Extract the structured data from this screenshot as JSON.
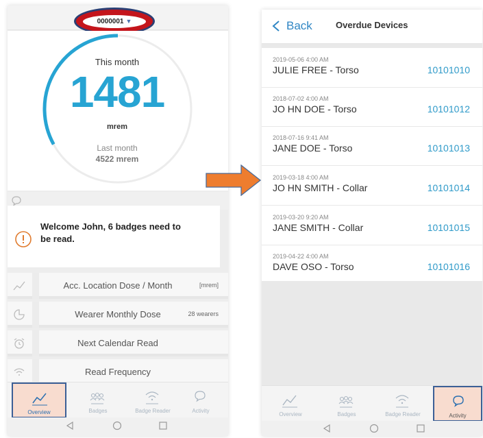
{
  "left": {
    "device_selector": {
      "value": "0000001"
    },
    "summary": {
      "this_month_label": "This month",
      "this_month_value": "1481",
      "unit": "mrem",
      "last_month_label": "Last month",
      "last_month_value": "4522 mrem",
      "gauge_fraction": 0.33
    },
    "welcome": {
      "text": "Welcome John, 6 badges need to be read."
    },
    "menu": [
      {
        "label": "Acc. Location Dose / Month",
        "meta": "[mrem]",
        "icon": "line-chart-icon"
      },
      {
        "label": "Wearer Monthly Dose",
        "meta": "28 wearers",
        "icon": "pie-chart-icon"
      },
      {
        "label": "Next Calendar Read",
        "meta": "",
        "icon": "alarm-clock-icon"
      },
      {
        "label": "Read Frequency",
        "meta": "",
        "icon": "wifi-icon"
      }
    ],
    "tabs": [
      {
        "label": "Overview",
        "icon": "line-chart-icon",
        "active": true
      },
      {
        "label": "Badges",
        "icon": "people-icon",
        "active": false
      },
      {
        "label": "Badge Reader",
        "icon": "wifi-icon",
        "active": false
      },
      {
        "label": "Activity",
        "icon": "chat-icon",
        "active": false
      }
    ]
  },
  "right": {
    "back_label": "Back",
    "title": "Overdue Devices",
    "devices": [
      {
        "datetime": "2019-05-06 4:00 AM",
        "name": "JULIE FREE - Torso",
        "id": "10101010"
      },
      {
        "datetime": "2018-07-02 4:00 AM",
        "name": "JO HN DOE - Torso",
        "id": "10101012"
      },
      {
        "datetime": "2018-07-16 9:41 AM",
        "name": "JANE DOE - Torso",
        "id": "10101013"
      },
      {
        "datetime": "2019-03-18 4:00 AM",
        "name": "JO HN SMITH - Collar",
        "id": "10101014"
      },
      {
        "datetime": "2019-03-20 9:20 AM",
        "name": "JANE SMITH - Collar",
        "id": "10101015"
      },
      {
        "datetime": "2019-04-22 4:00 AM",
        "name": "DAVE OSO - Torso",
        "id": "10101016"
      }
    ],
    "tabs": [
      {
        "label": "Overview",
        "icon": "line-chart-icon",
        "active": false
      },
      {
        "label": "Badges",
        "icon": "people-icon",
        "active": false
      },
      {
        "label": "Badge Reader",
        "icon": "wifi-icon",
        "active": false
      },
      {
        "label": "Activity",
        "icon": "chat-icon",
        "active": true
      }
    ]
  },
  "colors": {
    "accent": "#27a4d3",
    "link": "#2f86c4",
    "highlight_ring": "#c4151c",
    "highlight_border": "#3b5f96",
    "arrow": "#ee7d2f",
    "active_tab_bg": "#f8dccf"
  }
}
